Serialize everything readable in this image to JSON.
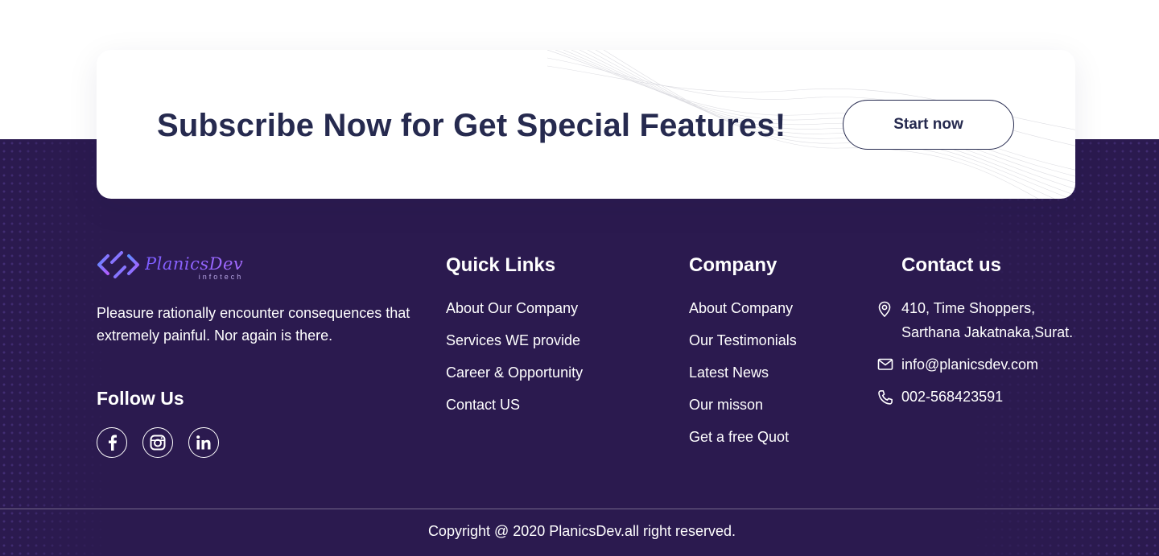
{
  "subscribe": {
    "title": "Subscribe Now for Get Special Features!",
    "button_label": "Start now"
  },
  "brand": {
    "name": "PlanicsDev",
    "tagline": "infotech",
    "about": "Pleasure rationally encounter consequences that extremely painful. Nor again is there.",
    "accent": "#7b5cff"
  },
  "follow": {
    "title": "Follow Us",
    "icons": [
      "facebook-icon",
      "instagram-icon",
      "linkedin-icon"
    ]
  },
  "quick_links": {
    "title": "Quick Links",
    "items": [
      "About Our Company",
      "Services WE provide",
      "Career & Opportunity",
      "Contact US"
    ]
  },
  "company": {
    "title": "Company",
    "items": [
      "About Company",
      "Our Testimonials",
      "Latest News",
      "Our misson",
      "Get a free Quot"
    ]
  },
  "contact": {
    "title": "Contact us",
    "address_line1": "410, Time Shoppers,",
    "address_line2": "Sarthana Jakatnaka,Surat.",
    "email": "info@planicsdev.com",
    "phone": "002-568423591"
  },
  "copyright": "Copyright @ 2020 PlanicsDev.all right reserved.",
  "colors": {
    "footer_bg": "#2b1a4f",
    "heading_dark": "#262a4f",
    "text_light": "#ffffff"
  }
}
